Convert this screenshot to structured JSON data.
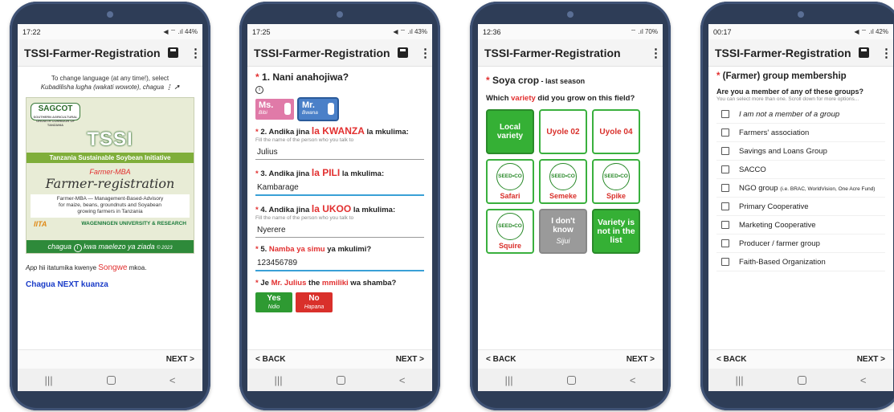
{
  "phones": [
    {
      "status_time": "17:22",
      "status_right": "◀ ⌔ .ıl 44%",
      "app_title": "TSSI-Farmer-Registration",
      "language_note_line1": "To change language (at any time!), select",
      "language_note_line2": "Kubadilisha lugha (wakati wowote), chagua",
      "banner": {
        "sagcot": "SAGCOT",
        "sagcot_sub": "SOUTHERN AGRICULTURAL GROWTH CORRIDOR OF TANZANIA",
        "tssi": "TSSI",
        "tssi_sub": "Tanzania Sustainable Soybean Initiative",
        "farmer_mba": "Farmer-MBA",
        "farmer_registration": "Farmer-registration",
        "desc_line1": "Farmer-MBA — Management-Based-Advisory",
        "desc_line2": "for maize, beans, groundnuts and Soyabean",
        "desc_line3": "growing farmers in Tanzania",
        "iita": "IITA",
        "wageningen": "WAGENINGEN UNIVERSITY & RESEARCH",
        "chagua_pre": "chagua",
        "chagua_post": "kwa maelezo ya ziada",
        "copyright": "© 2023"
      },
      "songwe_pre": "App",
      "songwe_mid": " hii itatumika kwenye ",
      "songwe_region": "Songwe",
      "songwe_post": " mkoa.",
      "next_instruction": "Chagua NEXT kuanza",
      "next_label": "NEXT >"
    },
    {
      "status_time": "17:25",
      "status_right": "◀ ⌔ .ıl 43%",
      "app_title": "TSSI-Farmer-Registration",
      "q1_num": "1.",
      "q1_text": "Nani anahojiwa?",
      "ms_label": "Ms.",
      "ms_sub": "Bibi",
      "mr_label": "Mr.",
      "mr_sub": "Bwana",
      "q2_pre": "2. Andika jina ",
      "q2_em": "la KWANZA",
      "q2_post": " la mkulima:",
      "q2_hint": "Fill the name of the person who you talk to",
      "q2_value": "Julius",
      "q3_pre": "3. Andika jina ",
      "q3_em": "la PILI",
      "q3_post": " la mkulima:",
      "q3_value": "Kambarage",
      "q4_pre": "4. Andika jina ",
      "q4_em": "la UKOO",
      "q4_post": " la mkulima:",
      "q4_hint": "Fill the name of the person who you talk to",
      "q4_value": "Nyerere",
      "q5_pre": "5. ",
      "q5_em": "Namba ya simu",
      "q5_post": " ya mkulimi?",
      "q5_value": "123456789",
      "q6_pre": "Je ",
      "q6_name": "Mr. Julius",
      "q6_mid": " the ",
      "q6_em": "mmiliki",
      "q6_post": " wa shamba?",
      "yes_label": "Yes",
      "yes_sub": "Ndio",
      "no_label": "No",
      "no_sub": "Hapana",
      "back_label": "< BACK",
      "next_label": "NEXT >"
    },
    {
      "status_time": "12:36",
      "status_right": "⌔ .ıl 70%",
      "app_title": "TSSI-Farmer-Registration",
      "heading": "Soya crop",
      "heading_sub": " - last season",
      "question_pre": "Which ",
      "question_em": "variety",
      "question_post": " did you grow on this field?",
      "varieties": [
        {
          "label": "Local variety",
          "kind": "local"
        },
        {
          "label": "Uyole 02",
          "kind": "text"
        },
        {
          "label": "Uyole 04",
          "kind": "text"
        },
        {
          "label": "Safari",
          "kind": "seedco"
        },
        {
          "label": "Semeke",
          "kind": "seedco"
        },
        {
          "label": "Spike",
          "kind": "seedco"
        },
        {
          "label": "Squire",
          "kind": "seedco"
        },
        {
          "label": "I don't know",
          "sub": "Sijui",
          "kind": "dontknow"
        },
        {
          "label": "Variety is not in the list",
          "kind": "notlist"
        }
      ],
      "seedco_text": "SEED•CO",
      "back_label": "< BACK",
      "next_label": "NEXT >"
    },
    {
      "status_time": "00:17",
      "status_right": "◀ ⌔ .ıl 42%",
      "app_title": "TSSI-Farmer-Registration",
      "heading": "(Farmer) group membership",
      "question": "Are you a member of any of these groups?",
      "hint": "You can select more than one. Scroll down for more options...",
      "groups": [
        "I am not a member of a group",
        "Farmers' association",
        "Savings and Loans Group",
        "SACCO",
        "NGO group",
        "Primary Cooperative",
        "Marketing Cooperative",
        "Producer / farmer group",
        "Faith-Based Organization"
      ],
      "ngo_note": "(i.e. BRAC, WorldVision, One Acre Fund)",
      "back_label": "< BACK",
      "next_label": "NEXT >"
    }
  ],
  "nav": {
    "recents": "|||",
    "home": "",
    "back": "<"
  }
}
